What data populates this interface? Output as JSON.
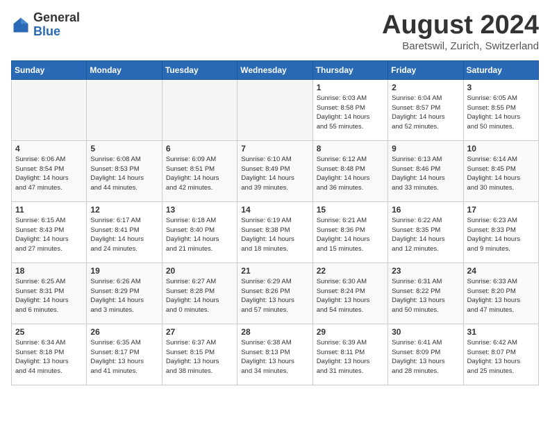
{
  "logo": {
    "general": "General",
    "blue": "Blue"
  },
  "title": {
    "month": "August 2024",
    "location": "Baretswil, Zurich, Switzerland"
  },
  "weekdays": [
    "Sunday",
    "Monday",
    "Tuesday",
    "Wednesday",
    "Thursday",
    "Friday",
    "Saturday"
  ],
  "weeks": [
    [
      {
        "day": "",
        "info": ""
      },
      {
        "day": "",
        "info": ""
      },
      {
        "day": "",
        "info": ""
      },
      {
        "day": "",
        "info": ""
      },
      {
        "day": "1",
        "info": "Sunrise: 6:03 AM\nSunset: 8:58 PM\nDaylight: 14 hours\nand 55 minutes."
      },
      {
        "day": "2",
        "info": "Sunrise: 6:04 AM\nSunset: 8:57 PM\nDaylight: 14 hours\nand 52 minutes."
      },
      {
        "day": "3",
        "info": "Sunrise: 6:05 AM\nSunset: 8:55 PM\nDaylight: 14 hours\nand 50 minutes."
      }
    ],
    [
      {
        "day": "4",
        "info": "Sunrise: 6:06 AM\nSunset: 8:54 PM\nDaylight: 14 hours\nand 47 minutes."
      },
      {
        "day": "5",
        "info": "Sunrise: 6:08 AM\nSunset: 8:53 PM\nDaylight: 14 hours\nand 44 minutes."
      },
      {
        "day": "6",
        "info": "Sunrise: 6:09 AM\nSunset: 8:51 PM\nDaylight: 14 hours\nand 42 minutes."
      },
      {
        "day": "7",
        "info": "Sunrise: 6:10 AM\nSunset: 8:49 PM\nDaylight: 14 hours\nand 39 minutes."
      },
      {
        "day": "8",
        "info": "Sunrise: 6:12 AM\nSunset: 8:48 PM\nDaylight: 14 hours\nand 36 minutes."
      },
      {
        "day": "9",
        "info": "Sunrise: 6:13 AM\nSunset: 8:46 PM\nDaylight: 14 hours\nand 33 minutes."
      },
      {
        "day": "10",
        "info": "Sunrise: 6:14 AM\nSunset: 8:45 PM\nDaylight: 14 hours\nand 30 minutes."
      }
    ],
    [
      {
        "day": "11",
        "info": "Sunrise: 6:15 AM\nSunset: 8:43 PM\nDaylight: 14 hours\nand 27 minutes."
      },
      {
        "day": "12",
        "info": "Sunrise: 6:17 AM\nSunset: 8:41 PM\nDaylight: 14 hours\nand 24 minutes."
      },
      {
        "day": "13",
        "info": "Sunrise: 6:18 AM\nSunset: 8:40 PM\nDaylight: 14 hours\nand 21 minutes."
      },
      {
        "day": "14",
        "info": "Sunrise: 6:19 AM\nSunset: 8:38 PM\nDaylight: 14 hours\nand 18 minutes."
      },
      {
        "day": "15",
        "info": "Sunrise: 6:21 AM\nSunset: 8:36 PM\nDaylight: 14 hours\nand 15 minutes."
      },
      {
        "day": "16",
        "info": "Sunrise: 6:22 AM\nSunset: 8:35 PM\nDaylight: 14 hours\nand 12 minutes."
      },
      {
        "day": "17",
        "info": "Sunrise: 6:23 AM\nSunset: 8:33 PM\nDaylight: 14 hours\nand 9 minutes."
      }
    ],
    [
      {
        "day": "18",
        "info": "Sunrise: 6:25 AM\nSunset: 8:31 PM\nDaylight: 14 hours\nand 6 minutes."
      },
      {
        "day": "19",
        "info": "Sunrise: 6:26 AM\nSunset: 8:29 PM\nDaylight: 14 hours\nand 3 minutes."
      },
      {
        "day": "20",
        "info": "Sunrise: 6:27 AM\nSunset: 8:28 PM\nDaylight: 14 hours\nand 0 minutes."
      },
      {
        "day": "21",
        "info": "Sunrise: 6:29 AM\nSunset: 8:26 PM\nDaylight: 13 hours\nand 57 minutes."
      },
      {
        "day": "22",
        "info": "Sunrise: 6:30 AM\nSunset: 8:24 PM\nDaylight: 13 hours\nand 54 minutes."
      },
      {
        "day": "23",
        "info": "Sunrise: 6:31 AM\nSunset: 8:22 PM\nDaylight: 13 hours\nand 50 minutes."
      },
      {
        "day": "24",
        "info": "Sunrise: 6:33 AM\nSunset: 8:20 PM\nDaylight: 13 hours\nand 47 minutes."
      }
    ],
    [
      {
        "day": "25",
        "info": "Sunrise: 6:34 AM\nSunset: 8:18 PM\nDaylight: 13 hours\nand 44 minutes."
      },
      {
        "day": "26",
        "info": "Sunrise: 6:35 AM\nSunset: 8:17 PM\nDaylight: 13 hours\nand 41 minutes."
      },
      {
        "day": "27",
        "info": "Sunrise: 6:37 AM\nSunset: 8:15 PM\nDaylight: 13 hours\nand 38 minutes."
      },
      {
        "day": "28",
        "info": "Sunrise: 6:38 AM\nSunset: 8:13 PM\nDaylight: 13 hours\nand 34 minutes."
      },
      {
        "day": "29",
        "info": "Sunrise: 6:39 AM\nSunset: 8:11 PM\nDaylight: 13 hours\nand 31 minutes."
      },
      {
        "day": "30",
        "info": "Sunrise: 6:41 AM\nSunset: 8:09 PM\nDaylight: 13 hours\nand 28 minutes."
      },
      {
        "day": "31",
        "info": "Sunrise: 6:42 AM\nSunset: 8:07 PM\nDaylight: 13 hours\nand 25 minutes."
      }
    ]
  ]
}
